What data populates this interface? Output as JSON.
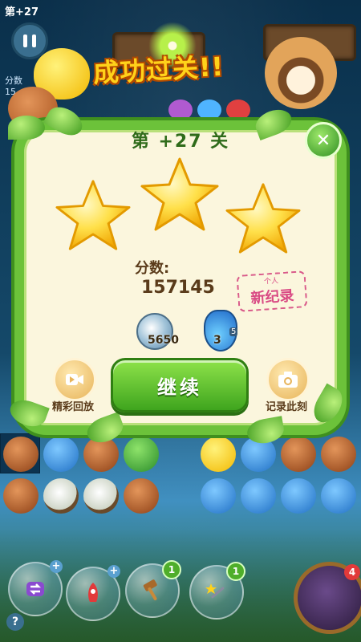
{
  "hud": {
    "level_prefix": "第",
    "level_number": "+27",
    "score_label": "分数",
    "score_partial": "15"
  },
  "banner": {
    "text": "成功过关!!"
  },
  "modal": {
    "title": "第 +27 关",
    "stars_earned": 3,
    "stars_total": 3,
    "score_label": "分数:",
    "score_value": "157145",
    "record_small": "个人",
    "record_text": "新纪录",
    "coins": "5650",
    "potion_count": "3",
    "potion_badge": "5",
    "continue_label": "继续",
    "replay_label": "精彩回放",
    "capture_label": "记录此刻",
    "close_icon": "close-icon"
  },
  "boosters": [
    {
      "name": "swap-booster",
      "badge": "+"
    },
    {
      "name": "rocket-booster",
      "badge": "+"
    },
    {
      "name": "hammer-booster",
      "badge": "1"
    },
    {
      "name": "wand-booster",
      "badge": "1"
    }
  ],
  "chest": {
    "badge": "4"
  },
  "help": {
    "label": "?"
  },
  "colors": {
    "frame_green": "#6cc23a",
    "panel": "#fbf6dd",
    "star_yellow": "#ffd21a",
    "button_green": "#3fa51e",
    "record_pink": "#d94a84",
    "banner_gold": "#ffd21a"
  }
}
